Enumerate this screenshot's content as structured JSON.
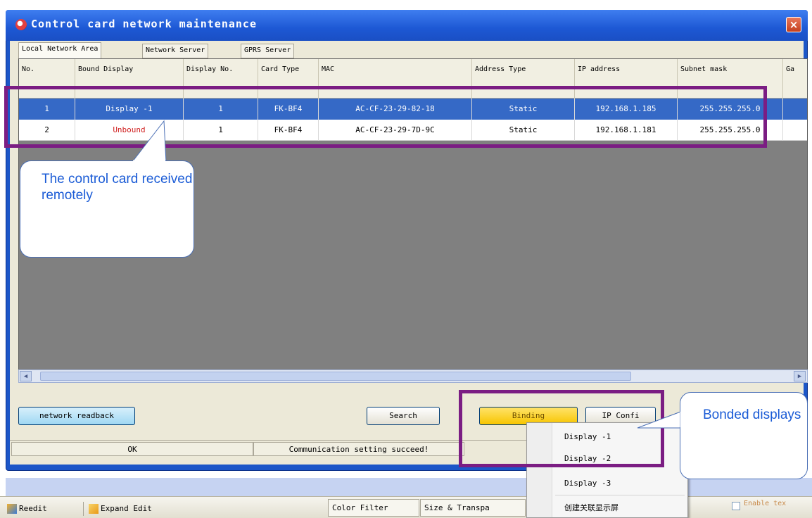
{
  "window": {
    "title": "Control card network maintenance",
    "close_label": "×"
  },
  "tabs": [
    {
      "label": "Local Network Area",
      "active": true
    },
    {
      "label": "Network Server",
      "active": false
    },
    {
      "label": "GPRS Server",
      "active": false
    }
  ],
  "table": {
    "headers": [
      "No.",
      "Bound Display",
      "Display No.",
      "Card Type",
      "MAC",
      "Address Type",
      "IP address",
      "Subnet mask",
      "Ga"
    ],
    "rows": [
      {
        "no": "1",
        "bound_display": "Display -1",
        "display_no": "1",
        "card_type": "FK-BF4",
        "mac": "AC-CF-23-29-82-18",
        "address_type": "Static",
        "ip": "192.168.1.185",
        "subnet": "255.255.255.0",
        "selected": true
      },
      {
        "no": "2",
        "bound_display": "Unbound",
        "display_no": "1",
        "card_type": "FK-BF4",
        "mac": "AC-CF-23-29-7D-9C",
        "address_type": "Static",
        "ip": "192.168.1.181",
        "subnet": "255.255.255.0",
        "selected": false
      }
    ]
  },
  "buttons": {
    "readback": "network readback",
    "search": "Search",
    "binding": "Binding",
    "ip_config": "IP Confi"
  },
  "status": {
    "left": "OK",
    "message": "Communication setting succeed!"
  },
  "context_menu": [
    "Display -1",
    "Display -2",
    "Display -3",
    "创建关联显示屏"
  ],
  "taskbar": {
    "items": [
      "Reedit",
      "Expand Edit"
    ],
    "tabs": [
      "Color Filter",
      "Size & Transpa"
    ],
    "enable_label": "Enable tex"
  },
  "callouts": {
    "left": "The control card received remotely",
    "right": "Bonded displays"
  },
  "colors": {
    "accent": "#7b1d83",
    "selected_row": "#3569c6",
    "unbound_text": "#d02020",
    "title_bar": "#1d58d4"
  }
}
